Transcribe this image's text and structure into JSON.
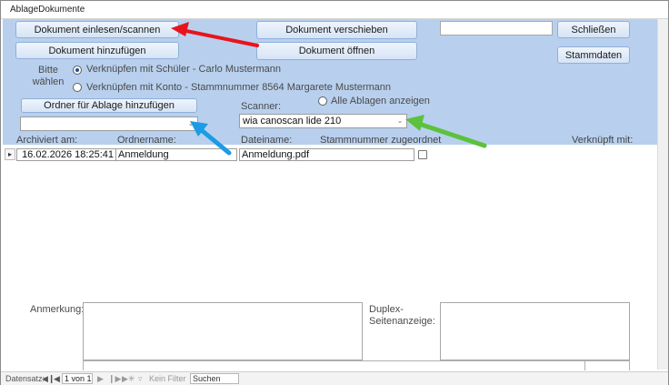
{
  "window": {
    "title": "AblageDokumente"
  },
  "buttons": {
    "scan": "Dokument einlesen/scannen",
    "add_document": "Dokument hinzufügen",
    "move_document": "Dokument verschieben",
    "open_document": "Dokument öffnen",
    "close": "Schließen",
    "master_data": "Stammdaten",
    "add_folder": "Ordner für Ablage hinzufügen"
  },
  "search": {
    "value": ""
  },
  "link_choice": {
    "label": "Bitte wählen",
    "option_student": "Verknüpfen mit Schüler - Carlo Mustermann",
    "option_account": "Verknüpfen mit Konto - Stammnummer 8564 Margarete Mustermann",
    "selected": "student"
  },
  "show_all": {
    "label": "Alle Ablagen anzeigen"
  },
  "scanner": {
    "label": "Scanner:",
    "value": "wia canoscan lide 210"
  },
  "folder_combo": {
    "value": ""
  },
  "columns": {
    "archived": "Archiviert am:",
    "folder": "Ordnername:",
    "filename": "Dateiname:",
    "assigned": "Stammnummer zugeordnet",
    "linked": "Verknüpft mit:"
  },
  "rows": [
    {
      "archived": "16.02.2026 18:25:41",
      "folder": "Anmeldung",
      "filename": "Anmeldung.pdf",
      "assigned": false
    }
  ],
  "detail": {
    "remark_label": "Anmerkung:",
    "duplex_label": "Duplex-Seitenanzeige:"
  },
  "navbar": {
    "label": "Datensatz:",
    "record": "1 von 1",
    "filter": "Kein Filter",
    "search": "Suchen"
  },
  "colors": {
    "header_bg": "#b8d0ee",
    "arrow_red": "#e8141c",
    "arrow_blue": "#1c9be6",
    "arrow_green": "#5cc13c"
  }
}
